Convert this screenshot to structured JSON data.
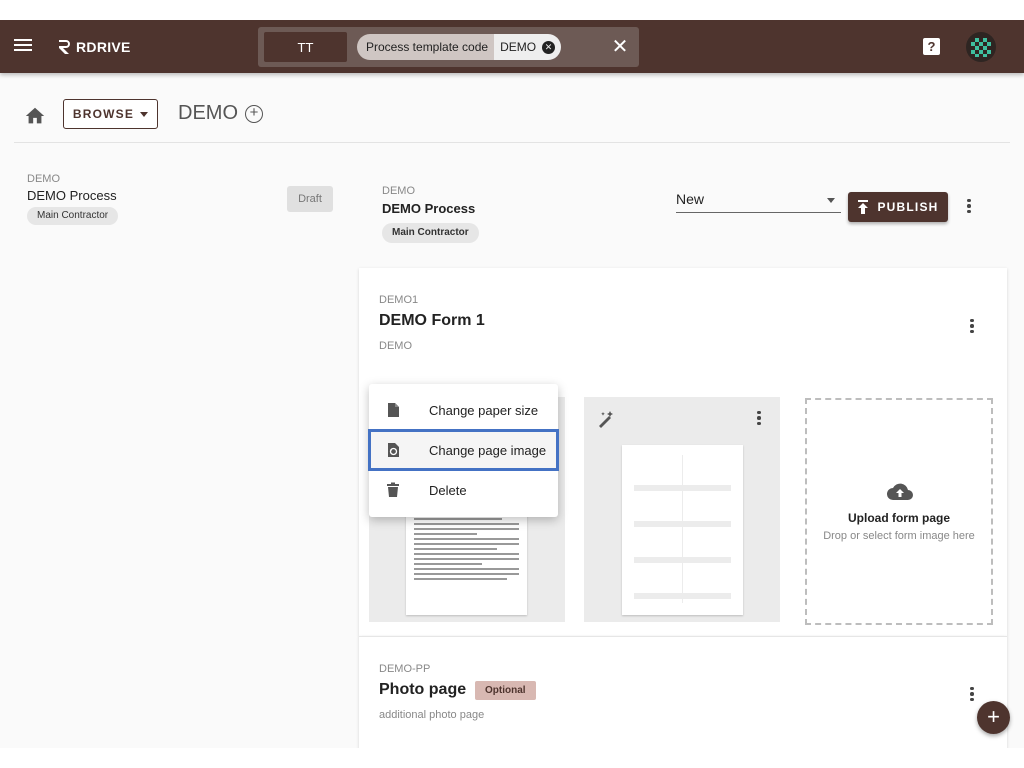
{
  "header": {
    "app_name": "RDRIVE",
    "search": {
      "tt_label": "TT",
      "filter_key": "Process template code",
      "filter_value": "DEMO"
    },
    "help_icon": "help-icon",
    "colors": {
      "header_bg": "#4e342e",
      "accent": "#4e342e",
      "selection_outline": "#4472c4"
    }
  },
  "breadcrumb": {
    "browse_label": "BROWSE",
    "title": "DEMO"
  },
  "process_list": [
    {
      "code": "DEMO",
      "name": "DEMO Process",
      "tag": "Main Contractor",
      "status": "Draft"
    }
  ],
  "process_detail": {
    "code": "DEMO",
    "name": "DEMO Process",
    "tag": "Main Contractor",
    "status_value": "New",
    "publish_label": "PUBLISH"
  },
  "form": {
    "code": "DEMO1",
    "name": "DEMO Form 1",
    "description": "DEMO",
    "upload_title": "Upload form page",
    "upload_subtitle": "Drop or select form image here"
  },
  "context_menu": {
    "items": [
      {
        "label": "Change paper size",
        "icon": "file-icon"
      },
      {
        "label": "Change page image",
        "icon": "image-replace-icon",
        "selected": true
      },
      {
        "label": "Delete",
        "icon": "trash-icon"
      }
    ]
  },
  "photo_page": {
    "code": "DEMO-PP",
    "name": "Photo page",
    "badge": "Optional",
    "description": "additional photo page"
  }
}
